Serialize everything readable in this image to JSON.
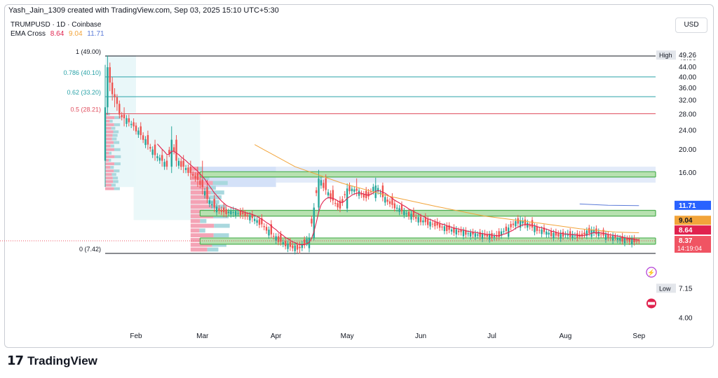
{
  "header": {
    "attribution": "Yash_Jain_1309 created with TradingView.com, Sep 03, 2025 15:10 UTC+5:30",
    "symbol": "TRUMPUSD · 1D · Coinbase",
    "indicator_label": "EMA Cross",
    "ema_values": [
      "8.64",
      "9.04",
      "11.71"
    ],
    "currency": "USD"
  },
  "footer": {
    "brand": "TradingView"
  },
  "colors": {
    "up": "#26a69a",
    "down": "#ef5350",
    "ema_fast": "#e0224e",
    "ema_mid": "#f2a43a",
    "ema_slow": "#5b7bd8",
    "fib_teal": "#2aa3a8",
    "fib_red": "#e05060",
    "zone_green": "#4caf50",
    "zone_blue": "#c8d8f5"
  },
  "chart_data": {
    "type": "candlestick",
    "y_scale": "log",
    "ylim": [
      3.8,
      56
    ],
    "y_ticks": [
      "48.00",
      "44.00",
      "40.00",
      "36.00",
      "32.00",
      "28.00",
      "24.00",
      "20.00",
      "16.00",
      "4.00"
    ],
    "x_ticks": [
      "Feb",
      "Mar",
      "Apr",
      "May",
      "Jun",
      "Jul",
      "Aug",
      "Sep"
    ],
    "x_tick_days": [
      13,
      41,
      72,
      102,
      133,
      163,
      194,
      225
    ],
    "fib_levels": [
      {
        "label": "1 (49.00)",
        "value": 49.0,
        "color": "#131722"
      },
      {
        "label": "0.786 (40.10)",
        "value": 40.1,
        "color": "#2aa3a8"
      },
      {
        "label": "0.62 (33.20)",
        "value": 33.2,
        "color": "#2aa3a8"
      },
      {
        "label": "0.5 (28.21)",
        "value": 28.21,
        "color": "#e05060"
      },
      {
        "label": "0 (7.42)",
        "value": 7.42,
        "color": "#131722"
      }
    ],
    "zones": [
      {
        "low": 15.4,
        "high": 16.2
      },
      {
        "low": 10.6,
        "high": 11.2
      },
      {
        "low": 8.1,
        "high": 8.6
      }
    ],
    "price_labels": [
      {
        "text": "High",
        "value": 49.26,
        "box": "#e3e6eb",
        "fg": "#131722",
        "value_text": "49.26"
      },
      {
        "text": "",
        "value": 11.71,
        "box": "#2962ff",
        "fg": "#ffffff",
        "value_text": "11.71"
      },
      {
        "text": "",
        "value": 10.15,
        "box": "#f2a43a",
        "fg": "#131722",
        "value_text": "9.04"
      },
      {
        "text": "",
        "value": 9.25,
        "box": "#e0224e",
        "fg": "#ffffff",
        "value_text": "8.64"
      },
      {
        "text": "",
        "value": 8.37,
        "box": "#f05463",
        "fg": "#ffffff",
        "value_text": "8.37",
        "sub": "14:19:04"
      },
      {
        "text": "Low",
        "value": 5.3,
        "box": "#e3e6eb",
        "fg": "#131722",
        "value_text": "7.15"
      }
    ],
    "anchor_points": [
      [
        0,
        18,
        45,
        14,
        30
      ],
      [
        1,
        30,
        49.26,
        28,
        44
      ],
      [
        2,
        44,
        46,
        35,
        38
      ],
      [
        3,
        38,
        40,
        32,
        34
      ],
      [
        4,
        34,
        36,
        30,
        33
      ],
      [
        5,
        33,
        34,
        29,
        31
      ],
      [
        6,
        31,
        32,
        27,
        28
      ],
      [
        8,
        28,
        30,
        25,
        27
      ],
      [
        10,
        27,
        28,
        25,
        26
      ],
      [
        12,
        26,
        27,
        24,
        25
      ],
      [
        15,
        25,
        26,
        22,
        23
      ],
      [
        18,
        23,
        24,
        20,
        21
      ],
      [
        21,
        21,
        22,
        18,
        19
      ],
      [
        24,
        19,
        20,
        17,
        18
      ],
      [
        26,
        18,
        19,
        16.5,
        17
      ],
      [
        28,
        17,
        25,
        16,
        22
      ],
      [
        30,
        22,
        23,
        17,
        18
      ],
      [
        33,
        18,
        19,
        16,
        17
      ],
      [
        36,
        17,
        18,
        15,
        16
      ],
      [
        39,
        16,
        17,
        14,
        15
      ],
      [
        41,
        15,
        18,
        13,
        14
      ],
      [
        43,
        14,
        15,
        12,
        12.5
      ],
      [
        46,
        12.5,
        13,
        11,
        11.5
      ],
      [
        50,
        11.5,
        12,
        10.5,
        11
      ],
      [
        54,
        11,
        11.6,
        10.5,
        11
      ],
      [
        58,
        11,
        11.5,
        10.3,
        10.8
      ],
      [
        62,
        10.8,
        11.2,
        10,
        10.4
      ],
      [
        66,
        10.4,
        10.8,
        9.5,
        9.8
      ],
      [
        70,
        9.8,
        10.2,
        8.6,
        8.9
      ],
      [
        74,
        8.9,
        9.2,
        8.0,
        8.3
      ],
      [
        78,
        8.3,
        8.6,
        7.6,
        7.9
      ],
      [
        82,
        7.9,
        8.3,
        7.4,
        7.8
      ],
      [
        86,
        7.8,
        9,
        7.5,
        8.6
      ],
      [
        88,
        8.6,
        12,
        8.4,
        11.5
      ],
      [
        90,
        11.5,
        16.5,
        11,
        15.2
      ],
      [
        93,
        15.2,
        15.8,
        13,
        13.6
      ],
      [
        96,
        13.6,
        14.2,
        11.8,
        12.3
      ],
      [
        99,
        12.3,
        12.8,
        11,
        11.4
      ],
      [
        102,
        11.4,
        14.5,
        11,
        13.8
      ],
      [
        106,
        13.8,
        15.2,
        12.8,
        13.5
      ],
      [
        110,
        13.5,
        14,
        12.2,
        12.6
      ],
      [
        114,
        12.6,
        15.3,
        12.2,
        14.2
      ],
      [
        117,
        14.2,
        14.6,
        12.2,
        12.7
      ],
      [
        121,
        12.7,
        13.2,
        11.4,
        11.8
      ],
      [
        125,
        11.8,
        12.2,
        10.8,
        11.1
      ],
      [
        130,
        11.1,
        11.5,
        10.2,
        10.5
      ],
      [
        135,
        10.5,
        10.9,
        9.7,
        10
      ],
      [
        140,
        10,
        10.4,
        9.4,
        9.7
      ],
      [
        145,
        9.7,
        10,
        9.0,
        9.3
      ],
      [
        150,
        9.3,
        9.6,
        8.8,
        9.1
      ],
      [
        155,
        9.1,
        9.4,
        8.6,
        8.9
      ],
      [
        160,
        8.9,
        9.3,
        8.5,
        8.8
      ],
      [
        165,
        8.8,
        9.2,
        8.4,
        8.7
      ],
      [
        170,
        8.7,
        9.8,
        8.5,
        9.5
      ],
      [
        175,
        9.5,
        10.6,
        9.2,
        10.2
      ],
      [
        180,
        10.2,
        10.5,
        9.2,
        9.5
      ],
      [
        185,
        9.5,
        9.8,
        8.9,
        9.1
      ],
      [
        190,
        9.1,
        9.4,
        8.6,
        8.8
      ],
      [
        195,
        8.8,
        9.3,
        8.5,
        8.9
      ],
      [
        200,
        8.9,
        9.2,
        8.5,
        8.7
      ],
      [
        205,
        8.7,
        9.6,
        8.5,
        9.3
      ],
      [
        210,
        9.3,
        9.5,
        8.6,
        8.8
      ],
      [
        215,
        8.8,
        9.0,
        8.4,
        8.6
      ],
      [
        220,
        8.6,
        8.8,
        8.2,
        8.4
      ],
      [
        225,
        8.4,
        8.6,
        8.1,
        8.37
      ]
    ],
    "ema_slow_points": [
      [
        63,
        21
      ],
      [
        80,
        17
      ],
      [
        100,
        14.5
      ],
      [
        120,
        12.8
      ],
      [
        140,
        11.6
      ],
      [
        160,
        10.6
      ],
      [
        180,
        10
      ],
      [
        200,
        9.4
      ],
      [
        215,
        9.1
      ],
      [
        225,
        9.04
      ]
    ],
    "ema_blue_points": [
      [
        200,
        11.9
      ],
      [
        212,
        11.75
      ],
      [
        225,
        11.71
      ]
    ],
    "volume_profile_left": {
      "day_start": 0,
      "day_end": 12,
      "rows": 22
    },
    "volume_profile_mid": {
      "day_start": 36,
      "day_end": 66,
      "rows": 18
    }
  }
}
